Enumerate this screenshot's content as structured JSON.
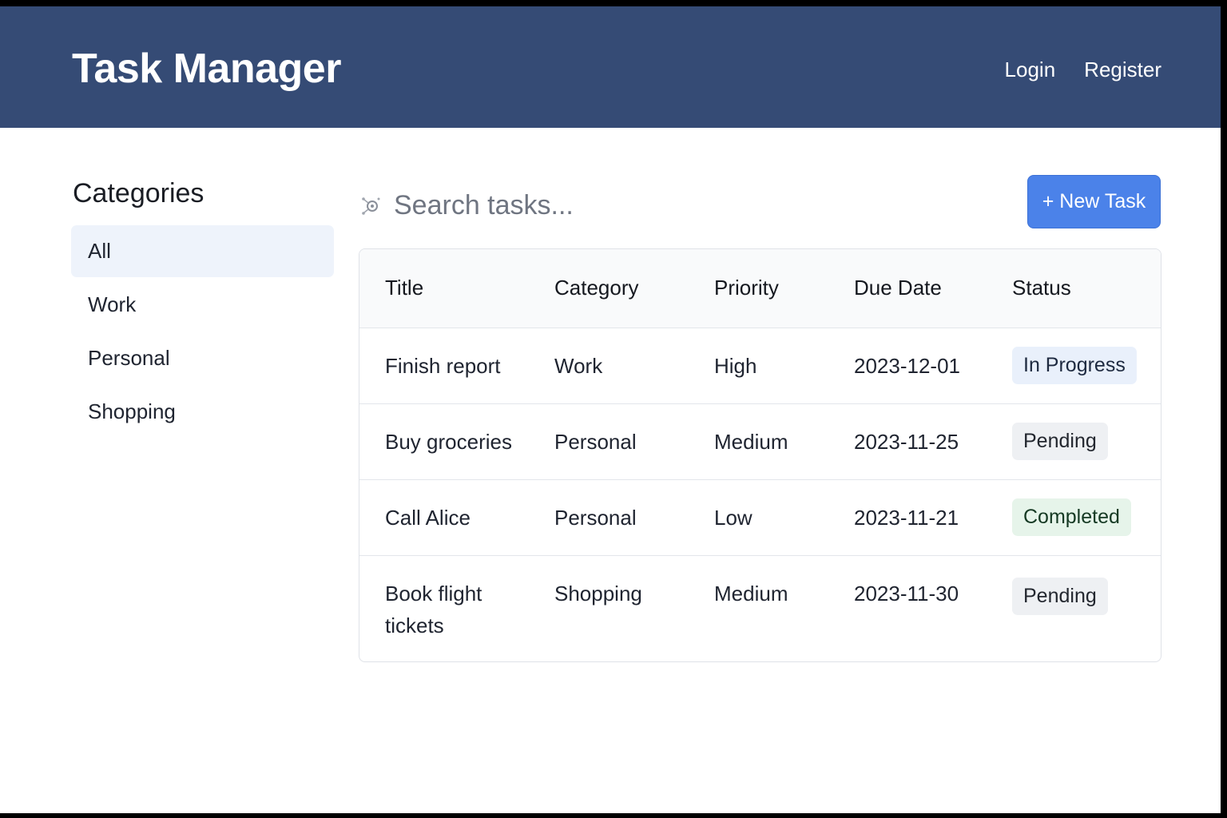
{
  "header": {
    "title": "Task Manager",
    "nav": {
      "login": "Login",
      "register": "Register"
    }
  },
  "sidebar": {
    "heading": "Categories",
    "items": [
      {
        "label": "All",
        "active": true
      },
      {
        "label": "Work"
      },
      {
        "label": "Personal"
      },
      {
        "label": "Shopping"
      }
    ]
  },
  "search": {
    "placeholder": "Search tasks..."
  },
  "toolbar": {
    "new_task_label": "+ New Task"
  },
  "table": {
    "columns": [
      "Title",
      "Category",
      "Priority",
      "Due Date",
      "Status"
    ],
    "rows": [
      {
        "title": "Finish report",
        "category": "Work",
        "priority": "High",
        "due": "2023-12-01",
        "status": "In Progress"
      },
      {
        "title": "Buy groceries",
        "category": "Personal",
        "priority": "Medium",
        "due": "2023-11-25",
        "status": "Pending"
      },
      {
        "title": "Call Alice",
        "category": "Personal",
        "priority": "Low",
        "due": "2023-11-21",
        "status": "Completed"
      },
      {
        "title": "Book flight tickets",
        "category": "Shopping",
        "priority": "Medium",
        "due": "2023-11-30",
        "status": "Pending"
      }
    ]
  },
  "colors": {
    "header_bg": "#354b75",
    "accent": "#4b82e9",
    "active_item_bg": "#eef3fb"
  },
  "icons": {
    "search": "search-icon"
  }
}
